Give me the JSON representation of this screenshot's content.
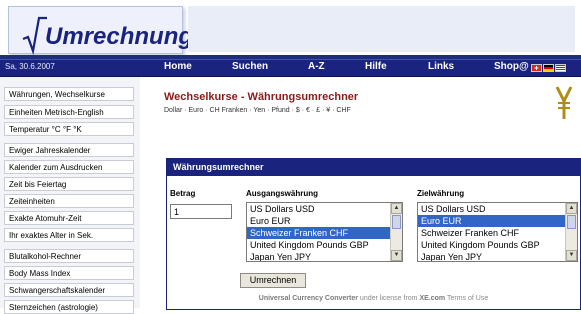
{
  "header": {
    "logo_text": "Umrechnung.org"
  },
  "nav": {
    "date": "Sa, 30.6.2007",
    "items": [
      "Home",
      "Suchen",
      "A-Z",
      "Hilfe",
      "Links",
      "Shop@"
    ]
  },
  "sidebar": {
    "items": [
      "Währungen, Wechselkurse",
      "Einheiten Metrisch-English",
      "Temperatur °C °F °K",
      "Ewiger Jahreskalender",
      "Kalender zum Ausdrucken",
      "Zeit bis Feiertag",
      "Zeiteinheiten",
      "Exakte Atomuhr-Zeit",
      "Ihr exaktes Alter in Sek.",
      "Blutalkohol-Rechner",
      "Body Mass Index",
      "Schwangerschaftskalender",
      "Sternzeichen (astrologie)"
    ]
  },
  "main": {
    "title": "Wechselkurse - Währungsumrechner",
    "subtitle": "Dollar · Euro · CH Franken · Yen · Pfund · $ · € · £ · ¥ · CHF"
  },
  "converter": {
    "heading": "Währungsumrechner",
    "amount_label": "Betrag",
    "amount_value": "1",
    "from_label": "Ausgangswährung",
    "to_label": "Zielwährung",
    "from_options": [
      "US Dollars USD",
      "Euro EUR",
      "Schweizer Franken CHF",
      "United Kingdom Pounds GBP",
      "Japan Yen JPY"
    ],
    "from_selected": "Schweizer Franken CHF",
    "to_options": [
      "US Dollars USD",
      "Euro EUR",
      "Schweizer Franken CHF",
      "United Kingdom Pounds GBP",
      "Japan Yen JPY"
    ],
    "to_selected": "Euro EUR",
    "button_label": "Umrechnen",
    "footer_brand": "Universal Currency Converter",
    "footer_mid": " under license from ",
    "footer_site": "XE.com",
    "footer_terms": " Terms of Use"
  },
  "colors": {
    "nav_blue": "#1a237e",
    "title_red": "#8b1a1a",
    "selection": "#3166c6"
  },
  "icons": [
    "sqrt-logo-icon",
    "yen-sign-icon",
    "swiss-flag-icon",
    "german-flag-icon",
    "uk-flag-icon"
  ]
}
